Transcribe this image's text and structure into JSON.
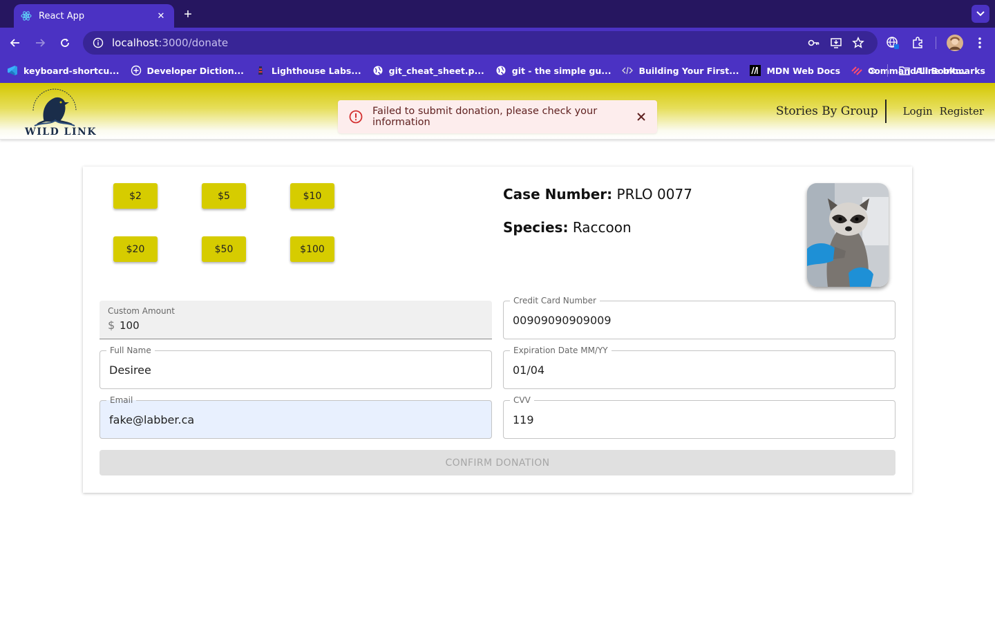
{
  "browser": {
    "tab_title": "React App",
    "url_host": "localhost",
    "url_path": ":3000/donate",
    "bookmarks": [
      {
        "label": "keyboard-shortcu...",
        "icon": "vscode-icon"
      },
      {
        "label": "Developer Diction...",
        "icon": "plus-circle-icon"
      },
      {
        "label": "Lighthouse Labs...",
        "icon": "lighthouse-icon"
      },
      {
        "label": "git_cheat_sheet.p...",
        "icon": "globe-icon"
      },
      {
        "label": "git - the simple gu...",
        "icon": "globe-icon"
      },
      {
        "label": "Building Your First...",
        "icon": "code-icon"
      },
      {
        "label": "MDN Web Docs",
        "icon": "mdn-icon"
      },
      {
        "label": "Command Line Int...",
        "icon": "stripes-icon"
      }
    ],
    "all_bookmarks": "All Bookmarks",
    "more_bookmarks": "»"
  },
  "app": {
    "logo_text": "WILD LINK",
    "nav": {
      "stories": "Stories By Group",
      "login": "Login",
      "register": "Register"
    },
    "alert": {
      "message": "Failed to submit donation, please check your information"
    },
    "preset_amounts": [
      "$2",
      "$5",
      "$10",
      "$20",
      "$50",
      "$100"
    ],
    "case": {
      "case_label": "Case Number:",
      "case_value": "PRLO 0077",
      "species_label": "Species:",
      "species_value": "Raccoon"
    },
    "form": {
      "custom_amount_label": "Custom Amount",
      "custom_amount_prefix": "$",
      "custom_amount_value": "100",
      "full_name_label": "Full Name",
      "full_name_value": "Desiree",
      "email_label": "Email",
      "email_value": "fake@labber.ca",
      "card_label": "Credit Card Number",
      "card_value": "00909090909009",
      "expiry_label": "Expiration Date MM/YY",
      "expiry_value": "01/04",
      "cvv_label": "CVV",
      "cvv_value": "119",
      "confirm_label": "CONFIRM DONATION"
    }
  },
  "colors": {
    "browser_dark": "#261660",
    "browser_accent": "#4b32c3",
    "header_yellow": "#d4c700",
    "button_yellow": "#d6cc00",
    "alert_bg": "#fdeded",
    "alert_red": "#d32f2f"
  }
}
